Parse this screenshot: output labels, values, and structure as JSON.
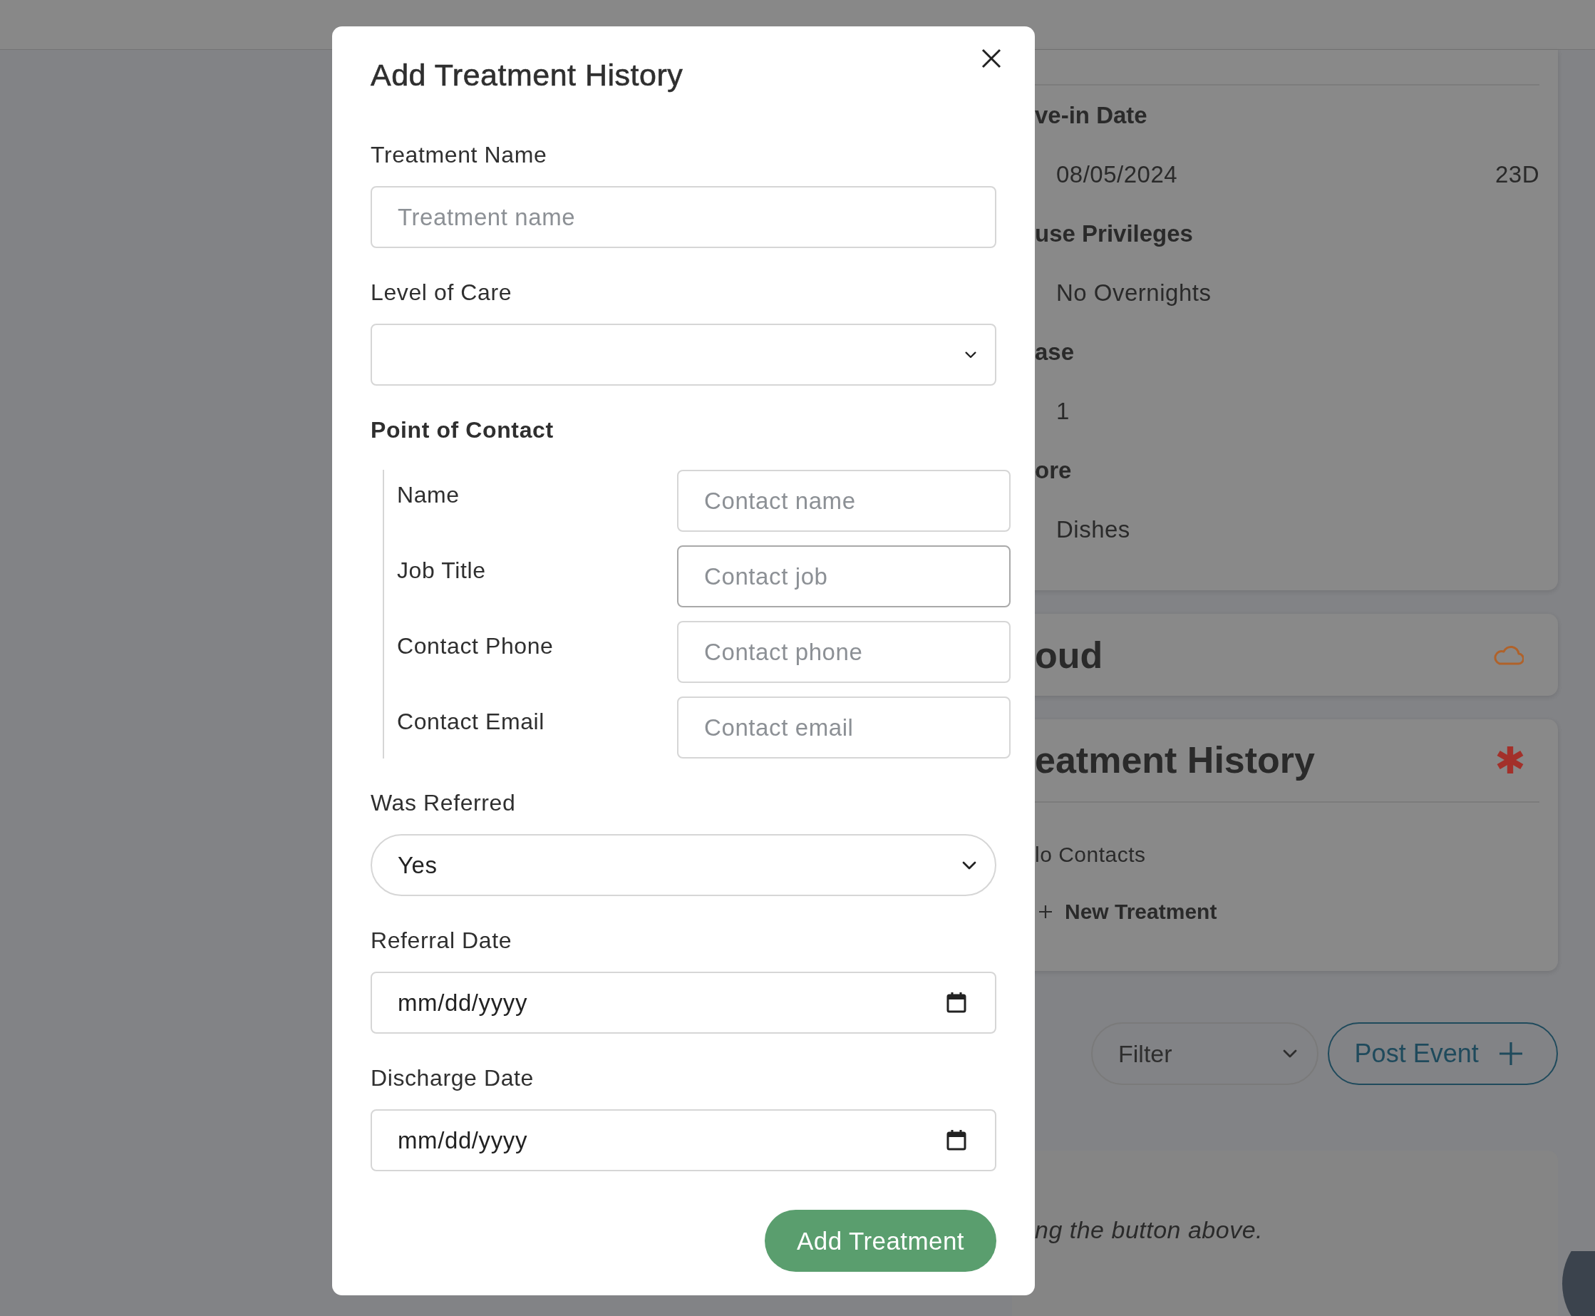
{
  "background": {
    "details_card": {
      "items": [
        {
          "label": "ve-in Date",
          "value": "08/05/2024",
          "extra": "23D"
        },
        {
          "label": "use Privileges",
          "value": "No Overnights"
        },
        {
          "label": "ase",
          "value": "1"
        },
        {
          "label": "ore",
          "value": "Dishes"
        }
      ]
    },
    "cloud_card": {
      "title": "oud"
    },
    "treatment_card": {
      "title": "eatment History",
      "empty_text": "lo Contacts",
      "new_button": "New Treatment"
    },
    "filter": {
      "value": "Filter"
    },
    "post_button": "Post Event",
    "feed_card": {
      "text": "ng the button above."
    }
  },
  "modal": {
    "title": "Add Treatment History",
    "fields": [
      {
        "kind": "text",
        "label": "Treatment Name",
        "placeholder": "Treatment name"
      },
      {
        "kind": "select",
        "label": "Level of Care"
      },
      {
        "kind": "contact_group",
        "label": "Point of Contact",
        "rows": [
          {
            "label": "Name",
            "placeholder": "Contact name",
            "focused": false
          },
          {
            "label": "Job Title",
            "placeholder": "Contact job",
            "focused": true
          },
          {
            "label": "Contact Phone",
            "placeholder": "Contact phone",
            "focused": false
          },
          {
            "label": "Contact Email",
            "placeholder": "Contact email",
            "focused": false
          }
        ]
      },
      {
        "kind": "pill_select",
        "label": "Was Referred",
        "value": "Yes"
      },
      {
        "kind": "date",
        "label": "Referral Date",
        "placeholder": "mm/dd/yyyy"
      },
      {
        "kind": "date",
        "label": "Discharge Date",
        "placeholder": "mm/dd/yyyy"
      }
    ],
    "submit": "Add Treatment"
  }
}
